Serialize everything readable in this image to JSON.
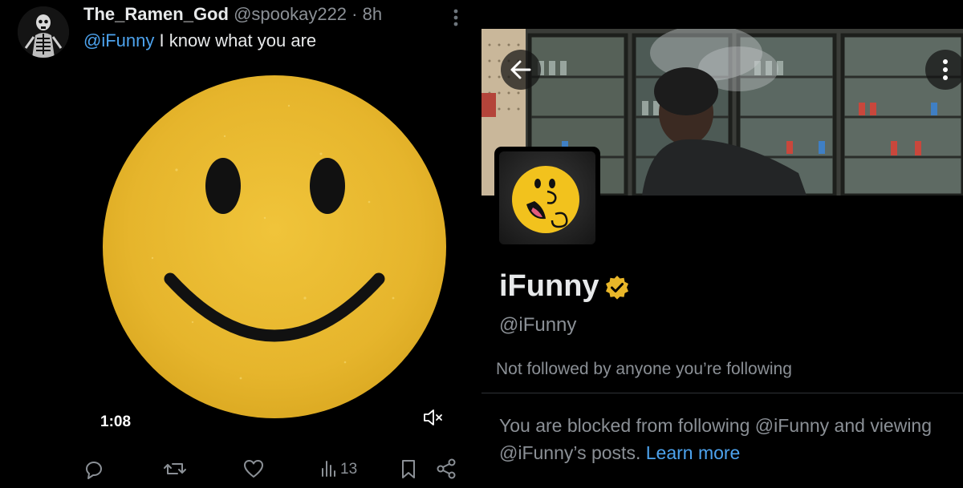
{
  "tweet": {
    "author_name": "The_Ramen_God",
    "author_handle": "@spookay222",
    "separator": " · ",
    "time": "8h",
    "mention": "@iFunny",
    "text": " I know what you are",
    "video_duration": "1:08",
    "views": "13",
    "icons": [
      "skeleton-avatar",
      "more-vertical-icon",
      "mute-icon",
      "reply-icon",
      "retweet-icon",
      "like-icon",
      "views-icon",
      "bookmark-icon",
      "share-icon"
    ],
    "media": "yellow smiley face"
  },
  "profile": {
    "display_name": "iFunny",
    "handle": "@iFunny",
    "followers_note": "Not followed by anyone you’re following",
    "blocked_text": "You are blocked from following @iFunny and viewing @iFunny’s posts.",
    "learn_more": "Learn more",
    "icons": [
      "back-arrow-icon",
      "more-icon",
      "verified-badge-icon",
      "ifunny-logo"
    ]
  },
  "colors": {
    "background": "#000000",
    "text": "#e7e9ea",
    "muted": "#8b9096",
    "link": "#4da3ee",
    "smiley": "#e8b82e",
    "verified": "#e8b629"
  }
}
